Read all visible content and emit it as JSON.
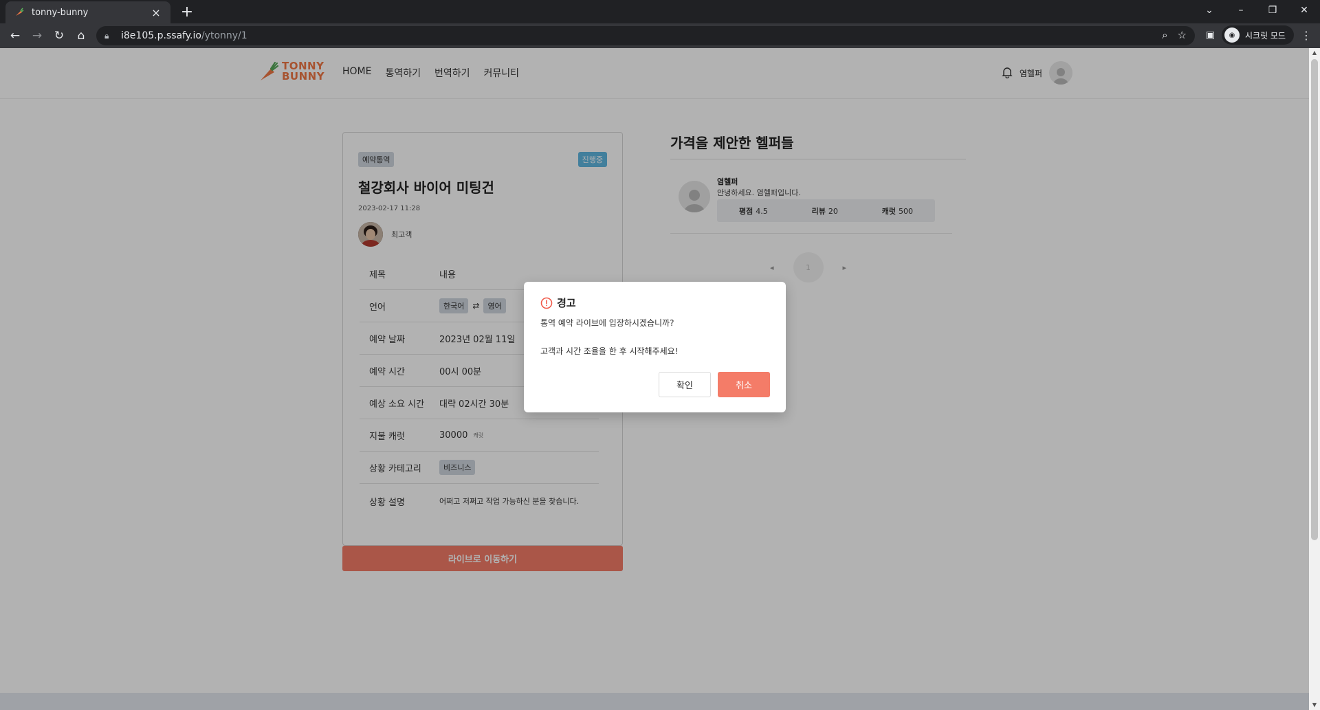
{
  "browser": {
    "tab_title": "tonny-bunny",
    "url_host": "i8e105.p.ssafy.io",
    "url_path": "/ytonny/1",
    "incognito_label": "시크릿 모드"
  },
  "header": {
    "logo_line1": "TONNY",
    "logo_line2": "BUNNY",
    "nav": [
      "HOME",
      "통역하기",
      "번역하기",
      "커뮤니티"
    ],
    "username": "염헬퍼"
  },
  "request": {
    "type_tag": "예약통역",
    "status_tag": "진행중",
    "title": "철강회사 바이어 미팅건",
    "date": "2023-02-17 11:28",
    "requester": "최고객",
    "table_header_key": "제목",
    "table_header_value": "내용",
    "rows": {
      "language": {
        "label": "언어",
        "from": "한국어",
        "to": "영어"
      },
      "date": {
        "label": "예약 날짜",
        "value": "2023년 02월 11일"
      },
      "time": {
        "label": "예약 시간",
        "value": "00시 00분"
      },
      "duration": {
        "label": "예상 소요 시간",
        "value": "대략 02시간 30분"
      },
      "carrot": {
        "label": "지불 캐럿",
        "value": "30000",
        "unit": "캐럿"
      },
      "category": {
        "label": "상황 카테고리",
        "value": "비즈니스"
      },
      "description": {
        "label": "상황 설명",
        "value": "어쩌고 저쩌고 작업 가능하신 분을 찾습니다."
      }
    },
    "live_button": "라이브로 이동하기"
  },
  "helpers": {
    "title": "가격을 제안한 헬퍼들",
    "list": [
      {
        "name": "염헬퍼",
        "intro": "안녕하세요. 염헬퍼입니다.",
        "rating_label": "평점",
        "rating": "4.5",
        "review_label": "리뷰",
        "reviews": "20",
        "carrot_label": "캐럿",
        "carrot": "500"
      }
    ],
    "page": "1"
  },
  "modal": {
    "title": "경고",
    "line1": "통역 예약 라이브에 입장하시겠습니까?",
    "line2": "고객과 시간 조율을 한 후 시작해주세요!",
    "confirm": "확인",
    "cancel": "취소"
  },
  "colors": {
    "accent": "#f47c68",
    "status_blue": "#5fb7e0",
    "chip_gray": "#cfd6de"
  }
}
